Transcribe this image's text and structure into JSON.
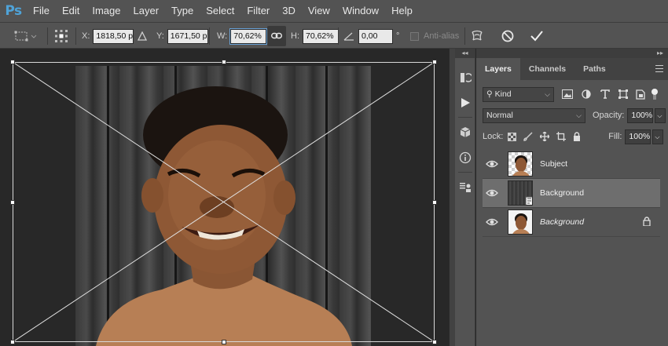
{
  "menubar": {
    "logo": "Ps",
    "items": [
      "File",
      "Edit",
      "Image",
      "Layer",
      "Type",
      "Select",
      "Filter",
      "3D",
      "View",
      "Window",
      "Help"
    ]
  },
  "options": {
    "x_label": "X:",
    "x_value": "1818,50 p:",
    "y_label": "Y:",
    "y_value": "1671,50 p:",
    "w_label": "W:",
    "w_value": "70,62%",
    "h_label": "H:",
    "h_value": "70,62%",
    "angle_value": "0,00",
    "angle_unit": "°",
    "antialias_label": "Anti-alias"
  },
  "layers_panel": {
    "tabs": [
      "Layers",
      "Channels",
      "Paths"
    ],
    "filter_kind": "Kind",
    "blend_mode": "Normal",
    "opacity_label": "Opacity:",
    "opacity_value": "100%",
    "lock_label": "Lock:",
    "fill_label": "Fill:",
    "fill_value": "100%",
    "layers": [
      {
        "name": "Subject",
        "italic": false,
        "selected": false,
        "locked": false
      },
      {
        "name": "Background",
        "italic": false,
        "selected": true,
        "locked": false
      },
      {
        "name": "Background",
        "italic": true,
        "selected": false,
        "locked": true
      }
    ]
  },
  "colors": {
    "ps_blue": "#4fa3d8",
    "ui_dark": "#535353",
    "selection": "#6e6e6e"
  }
}
